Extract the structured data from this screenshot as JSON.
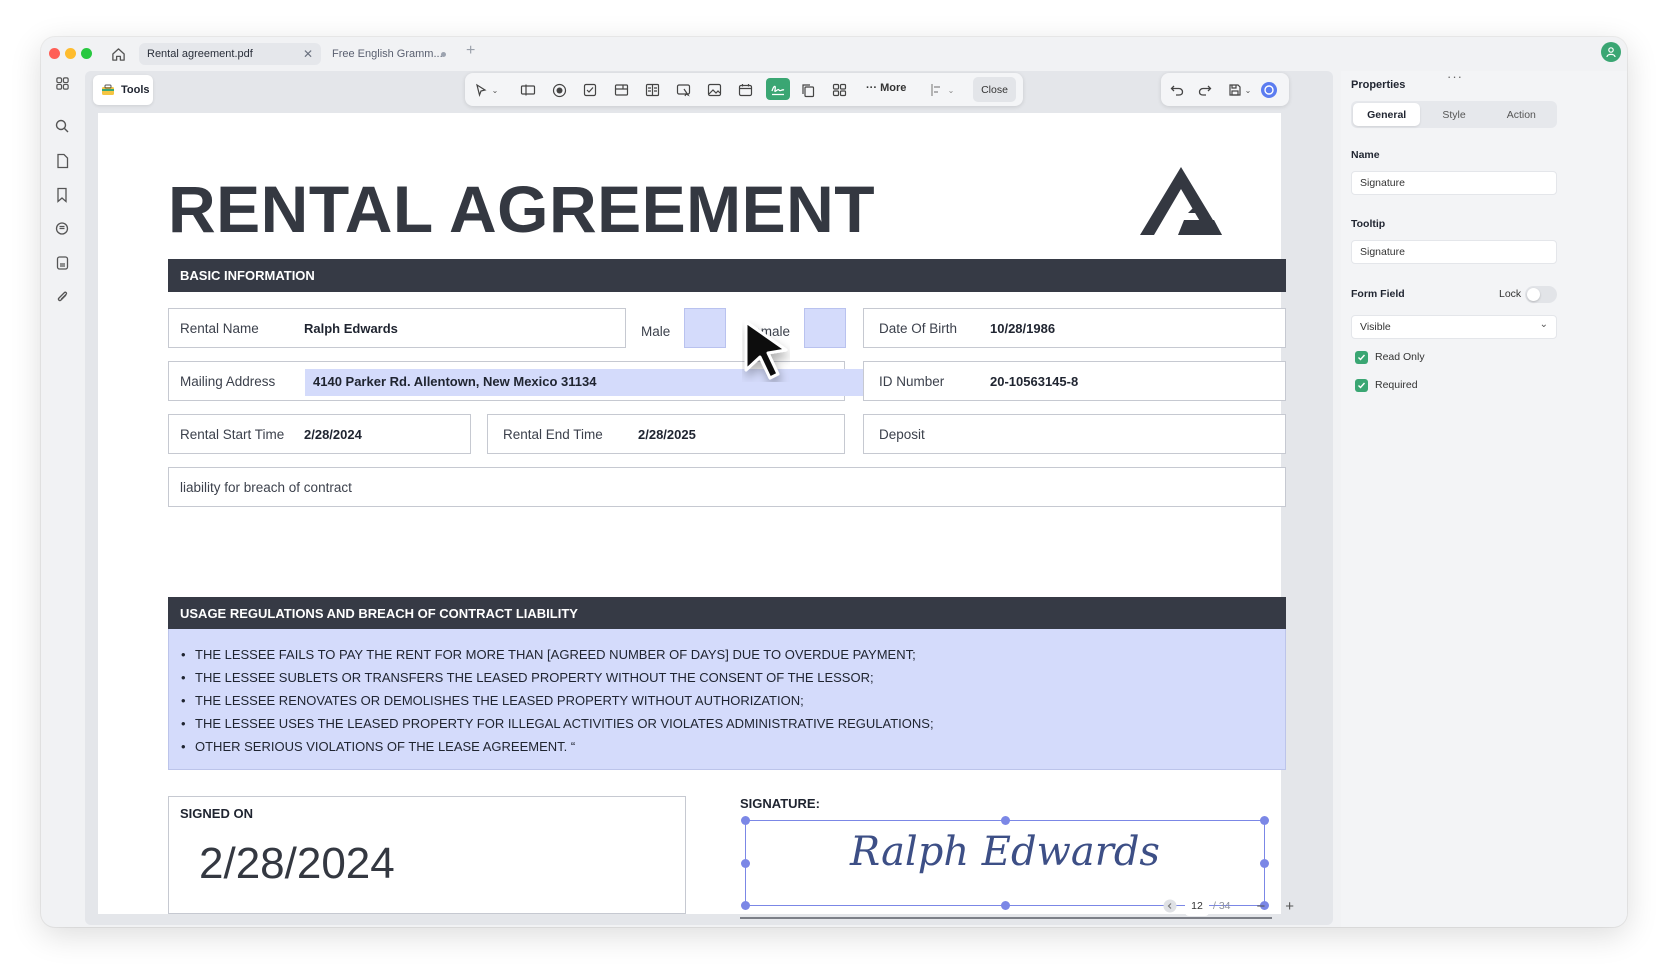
{
  "tabs": [
    {
      "label": "Rental agreement.pdf"
    },
    {
      "label": "Free English Gramm..."
    }
  ],
  "toolbar": {
    "more_label": "More",
    "close_label": "Close",
    "tools_label": "Tools"
  },
  "document": {
    "title": "RENTAL AGREEMENT",
    "section_basic": "BASIC INFORMATION",
    "rental_name_label": "Rental Name",
    "rental_name_value": "Ralph Edwards",
    "male_label": "Male",
    "female_label": "Female",
    "dob_label": "Date Of Birth",
    "dob_value": "10/28/1986",
    "mailing_label": "Mailing Address",
    "mailing_value": "4140 Parker Rd. Allentown, New Mexico 31134",
    "id_label": "ID Number",
    "id_value": "20-10563145-8",
    "start_label": "Rental Start Time",
    "start_value": "2/28/2024",
    "end_label": "Rental End Time",
    "end_value": "2/28/2025",
    "deposit_label": "Deposit",
    "liability_label": "liability for breach of contract",
    "section_usage": "USAGE REGULATIONS AND BREACH OF CONTRACT LIABILITY",
    "rules": [
      "THE LESSEE FAILS TO PAY THE RENT FOR MORE THAN [AGREED NUMBER OF DAYS] DUE TO OVERDUE PAYMENT;",
      "THE LESSEE SUBLETS OR TRANSFERS THE LEASED PROPERTY WITHOUT THE CONSENT OF THE LESSOR;",
      "THE LESSEE RENOVATES OR DEMOLISHES THE LEASED PROPERTY WITHOUT AUTHORIZATION;",
      "THE LESSEE USES THE LEASED PROPERTY FOR ILLEGAL ACTIVITIES OR VIOLATES ADMINISTRATIVE REGULATIONS;",
      "OTHER SERIOUS VIOLATIONS OF THE LEASE AGREEMENT. “"
    ],
    "signed_on_label": "SIGNED ON",
    "signed_on_value": "2/28/2024",
    "signature_label": "SIGNATURE:",
    "signature_value": "Ralph Edwards"
  },
  "pager": {
    "current": "12",
    "total": "/ 34"
  },
  "properties": {
    "title": "Properties",
    "tabs": [
      "General",
      "Style",
      "Action"
    ],
    "name_label": "Name",
    "name_value": "Signature",
    "tooltip_label": "Tooltip",
    "tooltip_value": "Signature",
    "form_field_label": "Form Field",
    "lock_label": "Lock",
    "visibility_value": "Visible",
    "read_only_label": "Read Only",
    "required_label": "Required"
  },
  "colors": {
    "accent": "#3aa673",
    "field_fill": "#d4dbfb",
    "section_bar": "#363a45",
    "selection": "#7b87e6"
  }
}
